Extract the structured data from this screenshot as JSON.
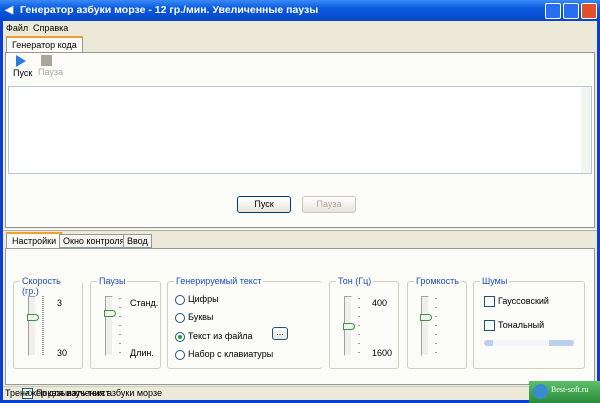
{
  "window": {
    "title": "Генератор азбуки морзе - 12 гр./мин. Увеличенные паузы"
  },
  "menu": [
    {
      "label": "Файл"
    },
    {
      "label": "Справка"
    }
  ],
  "top_tabs": [
    {
      "label": "Генератор кода"
    }
  ],
  "toolbar": {
    "start": "Пуск",
    "pause": "Пауза"
  },
  "text_area": {
    "value": ""
  },
  "buttons": {
    "start": "Пуск",
    "pause": "Пауза"
  },
  "bottom_tabs": [
    {
      "label": "Настройки",
      "active": true
    },
    {
      "label": "Окно контроля"
    },
    {
      "label": "Ввод"
    }
  ],
  "speed": {
    "label": "Скорость (гр.)",
    "min": "3",
    "max": "30"
  },
  "pauses": {
    "label": "Паузы",
    "min": "Станд.",
    "max": "Длин."
  },
  "generated": {
    "label": "Генерируемый текст",
    "options": [
      "Цифры",
      "Буквы",
      "Текст из файла",
      "Набор с клавиатуры"
    ],
    "selected": "Текст из файла",
    "browse": "..."
  },
  "tone": {
    "label": "Тон (Гц)",
    "min": "400",
    "max": "1600"
  },
  "volume": {
    "label": "Громкость"
  },
  "noise": {
    "label": "Шумы",
    "gaussian": "Гауссовский",
    "tonal": "Тональный",
    "gaussian_checked": false,
    "tonal_checked": false
  },
  "show_text": {
    "label": "Показывать текст",
    "checked": true
  },
  "status": "Тренажер для изучения азбуки морзе",
  "watermark": "Best-soft.ru"
}
